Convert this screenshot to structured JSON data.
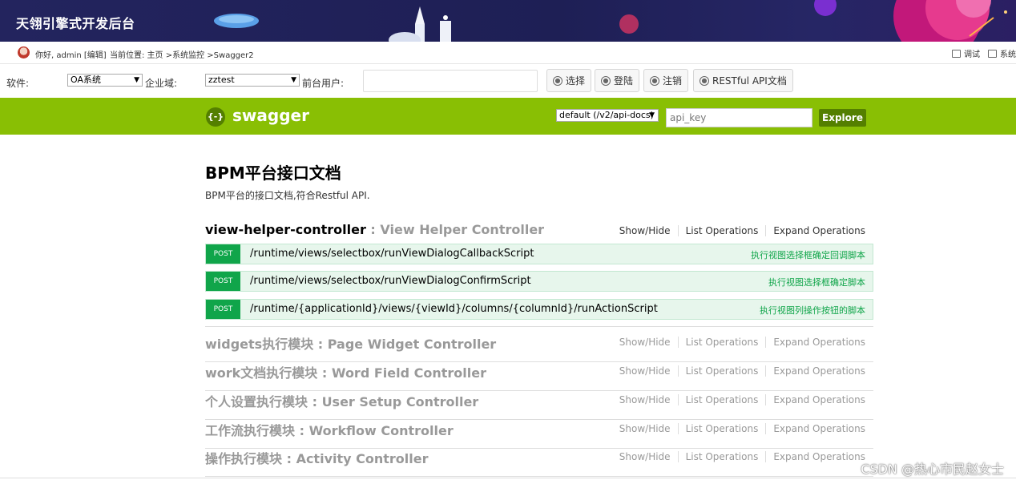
{
  "banner": {
    "title": "天翎引擎式开发后台"
  },
  "infobar": {
    "greeting": "你好, admin [编辑]",
    "breadcrumb": "当前位置: 主页 >系统监控 >Swagger2",
    "tools": [
      {
        "label": "调试",
        "icon": "debug-icon"
      },
      {
        "label": "系统",
        "icon": "system-icon"
      }
    ]
  },
  "filters": {
    "software_label": "软件:",
    "software_value": "OA系统",
    "domain_label": "企业域:",
    "domain_value": "zztest",
    "frontend_user_label": "前台用户:",
    "frontend_user_value": "",
    "buttons": [
      {
        "label": "选择",
        "icon": "select-icon"
      },
      {
        "label": "登陆",
        "icon": "login-icon"
      },
      {
        "label": "注销",
        "icon": "logout-icon"
      },
      {
        "label": "RESTful API文档",
        "icon": "api-doc-icon"
      }
    ]
  },
  "swagger": {
    "logo_glyph": "{-}",
    "name": "swagger",
    "spec_value": "default (/v2/api-docs)",
    "api_key_placeholder": "api_key",
    "explore_label": "Explore"
  },
  "doc": {
    "title": "BPM平台接口文档",
    "description": "BPM平台的接口文档,符合Restful API."
  },
  "resources": [
    {
      "controller": "view-helper-controller",
      "separator": " : ",
      "description": "View Helper Controller",
      "ops": [
        "Show/Hide",
        "List Operations",
        "Expand Operations"
      ],
      "operations": [
        {
          "method": "POST",
          "path": "/runtime/views/selectbox/runViewDialogCallbackScript",
          "summary": "执行视图选择框确定回调脚本"
        },
        {
          "method": "POST",
          "path": "/runtime/views/selectbox/runViewDialogConfirmScript",
          "summary": "执行视图选择框确定脚本"
        },
        {
          "method": "POST",
          "path": "/runtime/{applicationId}/views/{viewId}/columns/{columnId}/runActionScript",
          "summary": "执行视图列操作按钮的脚本"
        }
      ]
    },
    {
      "controller": "widgets执行模块",
      "separator": " : ",
      "description": "Page Widget Controller",
      "ops": [
        "Show/Hide",
        "List Operations",
        "Expand Operations"
      ]
    },
    {
      "controller": "work文档执行模块",
      "separator": " : ",
      "description": "Word Field Controller",
      "ops": [
        "Show/Hide",
        "List Operations",
        "Expand Operations"
      ]
    },
    {
      "controller": "个人设置执行模块",
      "separator": " : ",
      "description": "User Setup Controller",
      "ops": [
        "Show/Hide",
        "List Operations",
        "Expand Operations"
      ]
    },
    {
      "controller": "工作流执行模块",
      "separator": " : ",
      "description": "Workflow Controller",
      "ops": [
        "Show/Hide",
        "List Operations",
        "Expand Operations"
      ]
    },
    {
      "controller": "操作执行模块",
      "separator": " : ",
      "description": "Activity Controller",
      "ops": [
        "Show/Hide",
        "List Operations",
        "Expand Operations"
      ]
    }
  ],
  "watermark": "CSDN @热心市民赵女士",
  "colors": {
    "swagger_green": "#89bf04",
    "post_green": "#10a54a",
    "banner_navy": "#1e1f55"
  }
}
